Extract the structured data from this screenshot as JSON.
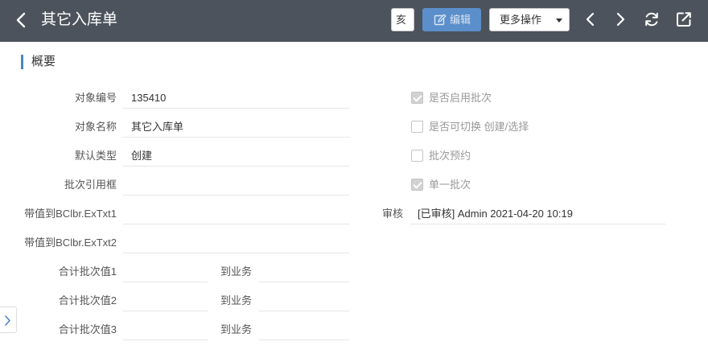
{
  "header": {
    "title": "其它入库单",
    "partial_button_label": "亥",
    "edit_label": "编辑",
    "more_label": "更多操作",
    "icons": [
      "back-icon",
      "edit-icon",
      "caret-down-icon",
      "prev-icon",
      "next-icon",
      "refresh-icon",
      "share-icon"
    ]
  },
  "section": {
    "title": "概要"
  },
  "fields": {
    "object_no": {
      "label": "对象编号",
      "value": "135410"
    },
    "object_name": {
      "label": "对象名称",
      "value": "其它入库单"
    },
    "default_type": {
      "label": "默认类型",
      "value": "创建"
    },
    "batch_ref": {
      "label": "批次引用框",
      "value": ""
    },
    "bc_txt1": {
      "label": "带值到BClbr.ExTxt1",
      "value": ""
    },
    "bc_txt2": {
      "label": "带值到BClbr.ExTxt2",
      "value": ""
    },
    "sum1": {
      "label": "合计批次值1",
      "to_label": "到业务"
    },
    "sum2": {
      "label": "合计批次值2",
      "to_label": "到业务"
    },
    "sum3": {
      "label": "合计批次值3",
      "to_label": "到业务"
    }
  },
  "checks": [
    {
      "label": "是否启用批次",
      "checked": true
    },
    {
      "label": "是否可切换 创建/选择",
      "checked": false
    },
    {
      "label": "批次预约",
      "checked": false
    },
    {
      "label": "单一批次",
      "checked": true
    }
  ],
  "audit": {
    "label": "审核",
    "value": "[已审核] Admin 2021-04-20 10:19"
  },
  "colors": {
    "header_bg": "#4d535c",
    "accent": "#4a86c8",
    "edit_btn": "#5b8fcb"
  }
}
